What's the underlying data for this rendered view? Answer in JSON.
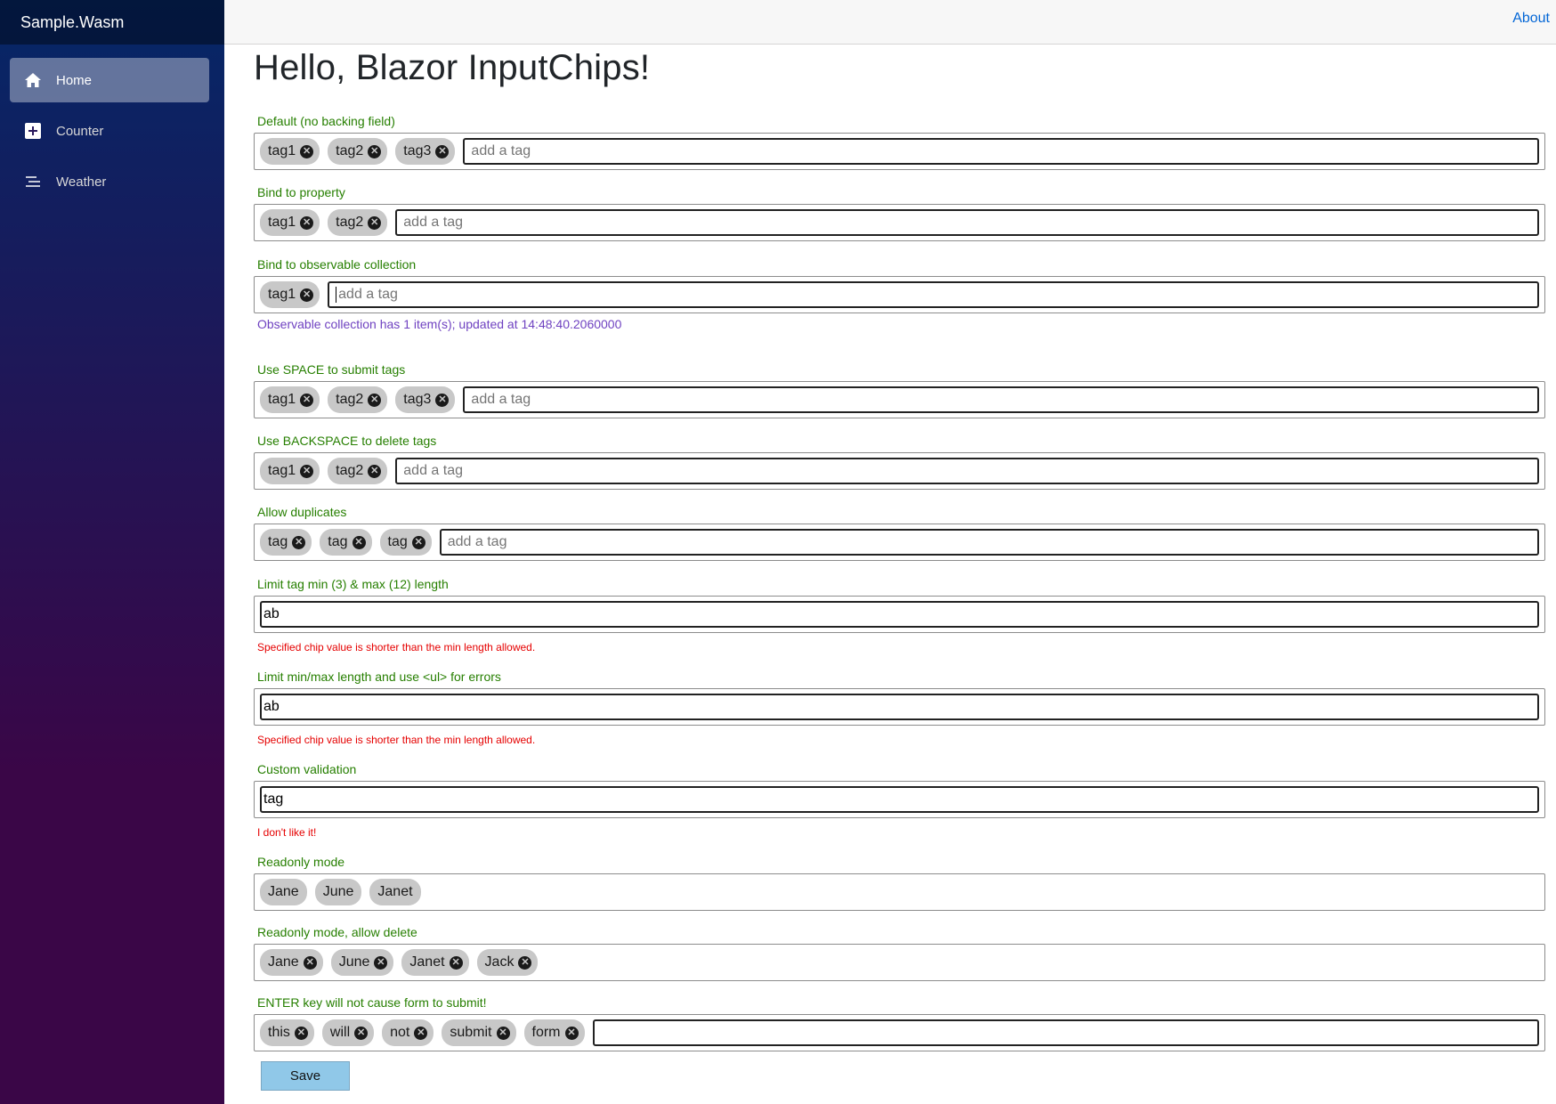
{
  "sidebar": {
    "brand": "Sample.Wasm",
    "items": [
      {
        "label": "Home",
        "icon": "home-icon",
        "active": true
      },
      {
        "label": "Counter",
        "icon": "plus-square-icon"
      },
      {
        "label": "Weather",
        "icon": "list-icon"
      }
    ]
  },
  "topbar": {
    "about": "About"
  },
  "page": {
    "title": "Hello, Blazor InputChips!"
  },
  "sections": {
    "default": {
      "label": "Default (no backing field)",
      "chips": [
        "tag1",
        "tag2",
        "tag3"
      ],
      "placeholder": "add a tag"
    },
    "bind_property": {
      "label": "Bind to property",
      "chips": [
        "tag1",
        "tag2"
      ],
      "placeholder": "add a tag"
    },
    "bind_observable": {
      "label": "Bind to observable collection",
      "chips": [
        "tag1"
      ],
      "placeholder": "add a tag",
      "info": "Observable collection has 1 item(s); updated at 14:48:40.2060000"
    },
    "space_submit": {
      "label": "Use SPACE to submit tags",
      "chips": [
        "tag1",
        "tag2",
        "tag3"
      ],
      "placeholder": "add a tag"
    },
    "backspace_delete": {
      "label": "Use BACKSPACE to delete tags",
      "chips": [
        "tag1",
        "tag2"
      ],
      "placeholder": "add a tag"
    },
    "allow_duplicates": {
      "label": "Allow duplicates",
      "chips": [
        "tag",
        "tag",
        "tag"
      ],
      "placeholder": "add a tag"
    },
    "limit_length": {
      "label": "Limit tag min (3) & max (12) length",
      "value": "ab",
      "error": "Specified chip value is shorter than the min length allowed."
    },
    "limit_length_ul": {
      "label": "Limit min/max length and use <ul> for errors",
      "value": "ab",
      "error": "Specified chip value is shorter than the min length allowed."
    },
    "custom_validation": {
      "label": "Custom validation",
      "value": "tag",
      "error": "I don't like it!"
    },
    "readonly": {
      "label": "Readonly mode",
      "chips": [
        "Jane",
        "June",
        "Janet"
      ]
    },
    "readonly_delete": {
      "label": "Readonly mode, allow delete",
      "chips": [
        "Jane",
        "June",
        "Janet",
        "Jack"
      ]
    },
    "enter_key": {
      "label": "ENTER key will not cause form to submit!",
      "chips": [
        "this",
        "will",
        "not",
        "submit",
        "form"
      ],
      "value": ""
    }
  },
  "form": {
    "save_label": "Save"
  },
  "colors": {
    "label_green": "#267f00",
    "info_purple": "#6f42c1",
    "error_red": "#e50000",
    "chip_bg": "#c8c8c8",
    "save_bg": "#90c8e8",
    "sidebar_top": "#052767",
    "sidebar_bottom": "#3a0647"
  }
}
